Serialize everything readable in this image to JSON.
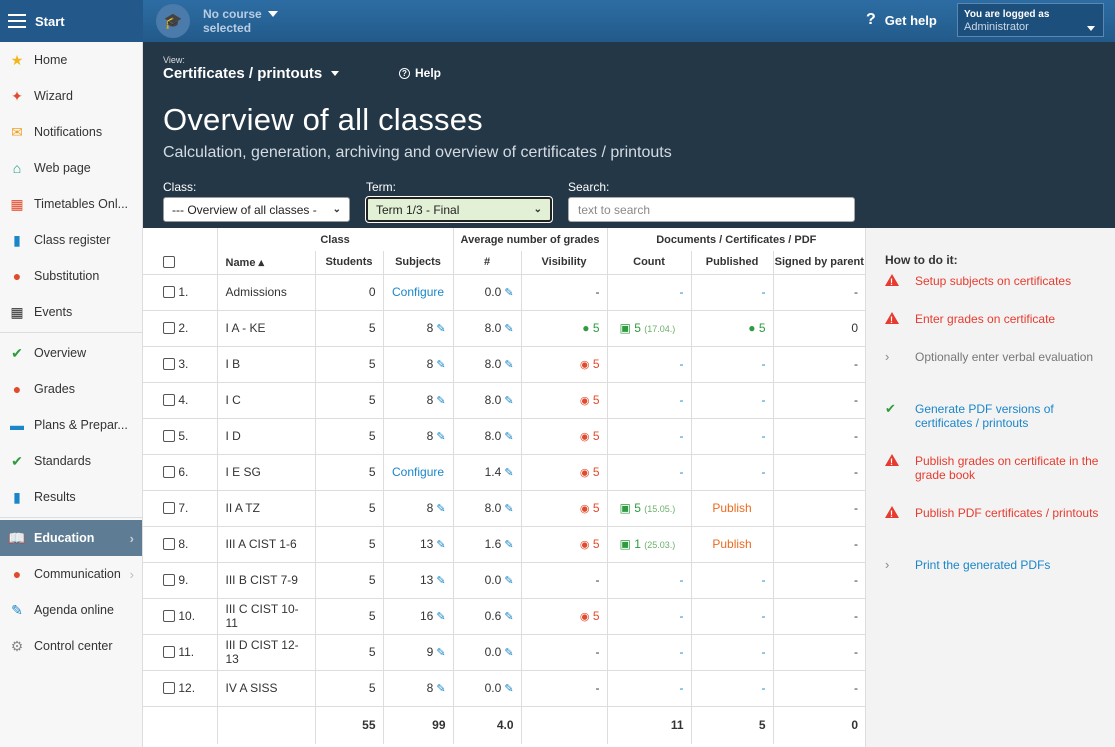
{
  "topbar": {
    "start_label": "Start",
    "course": "No course selected",
    "course_line1": "No course",
    "course_line2": "selected",
    "help": "Get help",
    "logged_label": "You are logged as",
    "user": "Administrator"
  },
  "sidebar": {
    "items": [
      {
        "label": "Home",
        "icon": "star-icon",
        "color": "#f2b51a"
      },
      {
        "label": "Wizard",
        "icon": "wand-icon",
        "color": "#e14b2c"
      },
      {
        "label": "Notifications",
        "icon": "envelope-icon",
        "color": "#f0a020"
      },
      {
        "label": "Web page",
        "icon": "house-icon",
        "color": "#1e9c8b"
      },
      {
        "label": "Timetables Onl...",
        "icon": "calendar-icon",
        "color": "#e14b2c"
      },
      {
        "label": "Class register",
        "icon": "book-icon",
        "color": "#1a86c8"
      },
      {
        "label": "Substitution",
        "icon": "person-icon",
        "color": "#e14b2c"
      },
      {
        "label": "Events",
        "icon": "calendar-grid-icon",
        "color": "#333"
      },
      {
        "label": "Overview",
        "icon": "check-circle-icon",
        "color": "#2e9b3f"
      },
      {
        "label": "Grades",
        "icon": "grade-icon",
        "color": "#e14b2c"
      },
      {
        "label": "Plans & Prepar...",
        "icon": "plans-icon",
        "color": "#1a86c8"
      },
      {
        "label": "Standards",
        "icon": "shield-check-icon",
        "color": "#2e9b3f"
      },
      {
        "label": "Results",
        "icon": "bar-chart-icon",
        "color": "#1a86c8"
      },
      {
        "label": "Education",
        "icon": "open-book-icon",
        "color": "#fff"
      },
      {
        "label": "Communication",
        "icon": "chat-icon",
        "color": "#e14b2c"
      },
      {
        "label": "Agenda online",
        "icon": "pen-icon",
        "color": "#1a86c8"
      },
      {
        "label": "Control center",
        "icon": "gear-icon",
        "color": "#888"
      }
    ]
  },
  "header": {
    "view_label": "View:",
    "view": "Certificates / printouts",
    "help": "Help",
    "title": "Overview of all classes",
    "subtitle": "Calculation, generation, archiving and overview of certificates / printouts",
    "class_label": "Class:",
    "class_value": "--- Overview of all classes -",
    "term_label": "Term:",
    "term_value": "Term 1/3 - Final",
    "search_label": "Search:",
    "search_placeholder": "text to search"
  },
  "table": {
    "group_headers": {
      "class": "Class",
      "avg": "Average number of grades",
      "docs": "Documents / Certificates / PDF"
    },
    "headers": {
      "name": "Name ▴",
      "students": "Students",
      "subjects": "Subjects",
      "num": "#",
      "visibility": "Visibility",
      "count": "Count",
      "published": "Published",
      "signed": "Signed by parent"
    },
    "rows": [
      {
        "no": "1.",
        "name": "Admissions",
        "students": "0",
        "subjects": "Configure",
        "avg": "0.0",
        "vis": "-",
        "count": "-",
        "pub": "-",
        "signed": "-"
      },
      {
        "no": "2.",
        "name": "I A - KE",
        "students": "5",
        "subjects": "8",
        "avg": "8.0",
        "vis": "5",
        "count": "5",
        "count_date": "(17.04.)",
        "pub": "5",
        "signed": "0"
      },
      {
        "no": "3.",
        "name": "I B",
        "students": "5",
        "subjects": "8",
        "avg": "8.0",
        "vis": "5",
        "count": "-",
        "pub": "-",
        "signed": "-"
      },
      {
        "no": "4.",
        "name": "I C",
        "students": "5",
        "subjects": "8",
        "avg": "8.0",
        "vis": "5",
        "count": "-",
        "pub": "-",
        "signed": "-"
      },
      {
        "no": "5.",
        "name": "I D",
        "students": "5",
        "subjects": "8",
        "avg": "8.0",
        "vis": "5",
        "count": "-",
        "pub": "-",
        "signed": "-"
      },
      {
        "no": "6.",
        "name": "I E SG",
        "students": "5",
        "subjects": "Configure",
        "avg": "1.4",
        "vis": "5",
        "count": "-",
        "pub": "-",
        "signed": "-"
      },
      {
        "no": "7.",
        "name": "II A TZ",
        "students": "5",
        "subjects": "8",
        "avg": "8.0",
        "vis": "5",
        "count": "5",
        "count_date": "(15.05.)",
        "pub": "Publish",
        "signed": "-"
      },
      {
        "no": "8.",
        "name": "III A CIST 1-6",
        "students": "5",
        "subjects": "13",
        "avg": "1.6",
        "vis": "5",
        "count": "1",
        "count_date": "(25.03.)",
        "pub": "Publish",
        "signed": "-"
      },
      {
        "no": "9.",
        "name": "III B CIST 7-9",
        "students": "5",
        "subjects": "13",
        "avg": "0.0",
        "vis": "-",
        "count": "-",
        "pub": "-",
        "signed": "-"
      },
      {
        "no": "10.",
        "name": "III C CIST 10-11",
        "students": "5",
        "subjects": "16",
        "avg": "0.6",
        "vis": "5",
        "count": "-",
        "pub": "-",
        "signed": "-"
      },
      {
        "no": "11.",
        "name": "III D CIST 12-13",
        "students": "5",
        "subjects": "9",
        "avg": "0.0",
        "vis": "-",
        "count": "-",
        "pub": "-",
        "signed": "-"
      },
      {
        "no": "12.",
        "name": "IV A SISS",
        "students": "5",
        "subjects": "8",
        "avg": "0.0",
        "vis": "-",
        "count": "-",
        "pub": "-",
        "signed": "-"
      }
    ],
    "totals": {
      "students": "55",
      "subjects": "99",
      "avg": "4.0",
      "count": "11",
      "pub": "5",
      "signed": "0"
    }
  },
  "howto": {
    "title": "How to do it:",
    "steps": [
      {
        "text": "Setup subjects on certificates",
        "icon": "warning-icon",
        "state": "red"
      },
      {
        "text": "Enter grades on certificate",
        "icon": "warning-icon",
        "state": "red"
      },
      {
        "text": "Optionally enter verbal evaluation",
        "icon": "chevron-right-icon",
        "state": "gray"
      },
      {
        "text": "Generate PDF versions of certificates / printouts",
        "icon": "check-icon",
        "state": "blue"
      },
      {
        "text": "Publish grades on certificate in the grade book",
        "icon": "warning-icon",
        "state": "red"
      },
      {
        "text": "Publish PDF certificates / printouts",
        "icon": "warning-icon",
        "state": "red"
      },
      {
        "text": "Print the generated PDFs",
        "icon": "chevron-right-icon",
        "state": "blue"
      }
    ]
  }
}
